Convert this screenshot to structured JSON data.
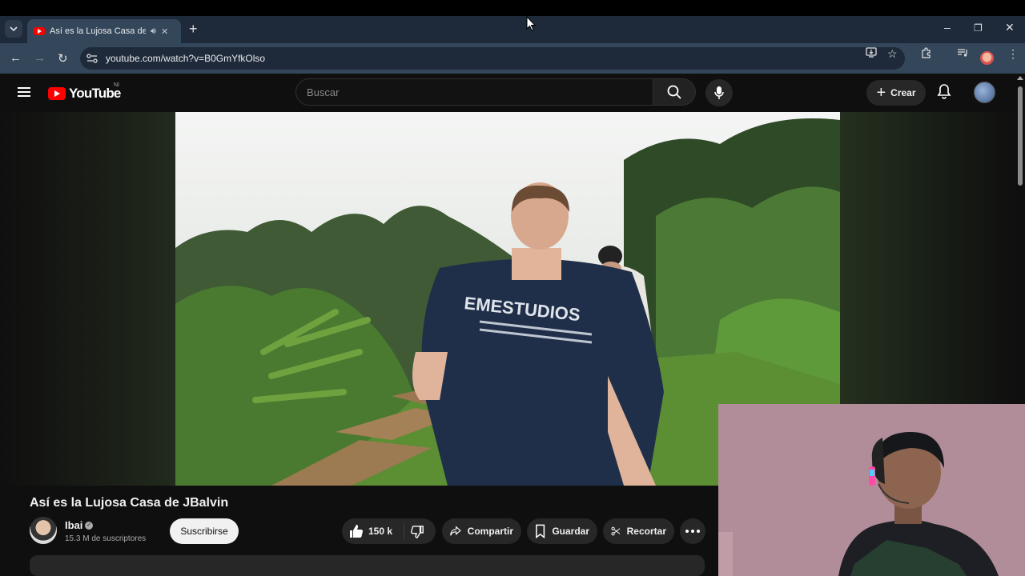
{
  "browser": {
    "tab_title": "Así es la Lujosa Casa de JBalvin",
    "tab_audio_icon": "speaker-icon",
    "new_tab_label": "+",
    "url": "youtube.com/watch?v=B0GmYfkOlso",
    "window_controls": {
      "minimize": "–",
      "maximize": "❐",
      "close": "✕"
    }
  },
  "youtube": {
    "logo_text": "YouTube",
    "country_code": "NI",
    "search_placeholder": "Buscar",
    "create_label": "Crear",
    "create_plus": "+"
  },
  "video": {
    "title": "Así es la Lujosa Casa de JBalvin",
    "channel_name": "Ibai",
    "channel_subs": "15.3 M de suscriptores",
    "subscribe_label": "Suscribirse",
    "likes": "150 k",
    "share_label": "Compartir",
    "save_label": "Guardar",
    "clip_label": "Recortar",
    "shirt_text": "EMESTUDIOS"
  },
  "colors": {
    "yt_red": "#ff0000",
    "page_bg": "#0f0f0f",
    "chrome_tab": "#34465a",
    "chrome_frame": "#1e2a3a"
  }
}
